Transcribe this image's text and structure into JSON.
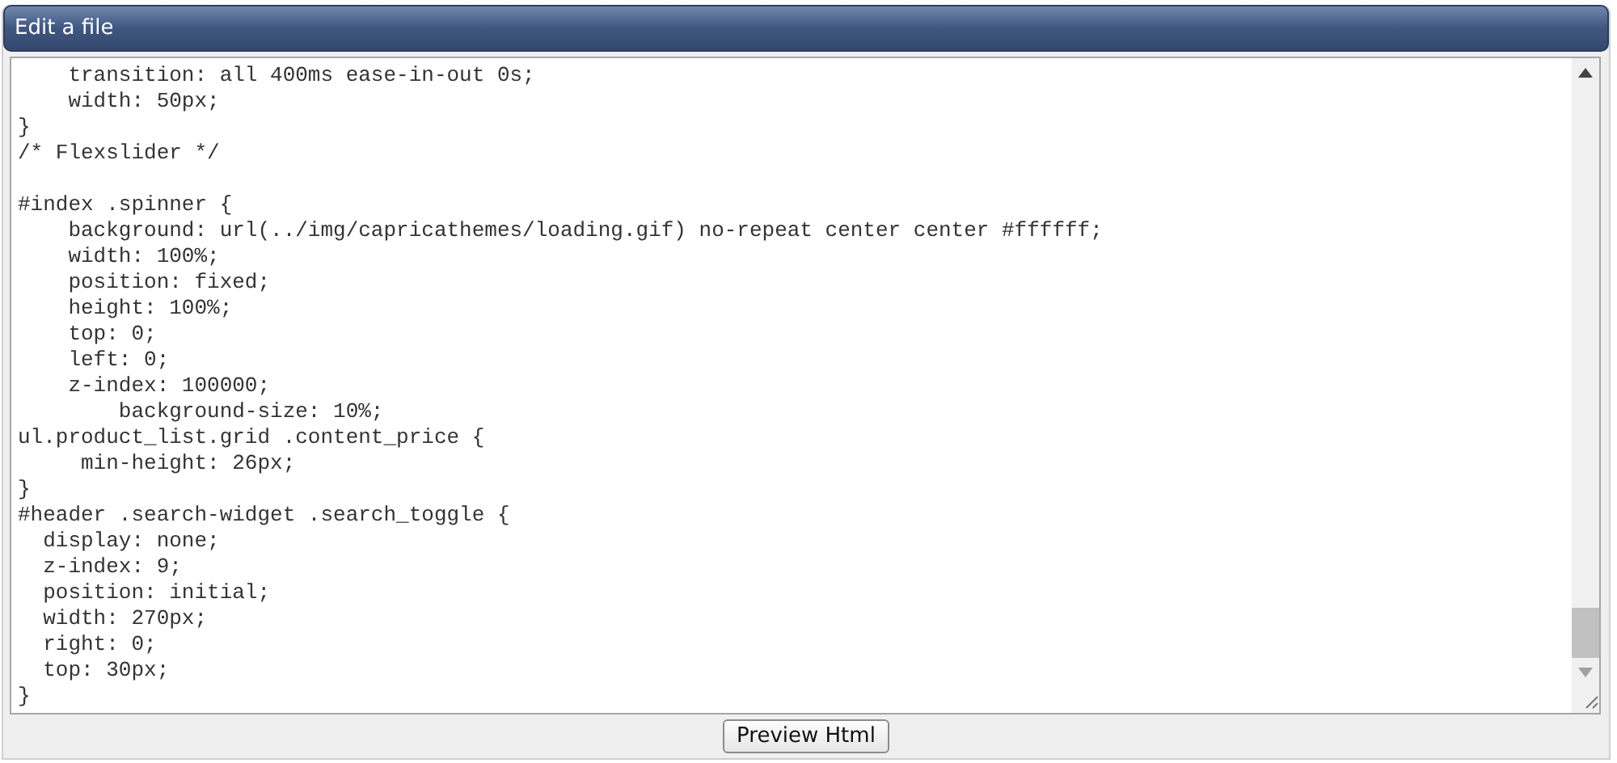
{
  "panel": {
    "title": "Edit a file"
  },
  "editor": {
    "value": "    transition: all 400ms ease-in-out 0s;\n    width: 50px;\n}\n/* Flexslider */\n\n#index .spinner {\n    background: url(../img/capricathemes/loading.gif) no-repeat center center #ffffff;\n    width: 100%;\n    position: fixed;\n    height: 100%;\n    top: 0;\n    left: 0;\n    z-index: 100000;\n        background-size: 10%;\nul.product_list.grid .content_price {\n     min-height: 26px;\n}\n#header .search-widget .search_toggle {\n  display: none;\n  z-index: 9;\n  position: initial;\n  width: 270px;\n  right: 0;\n  top: 30px;\n}"
  },
  "buttons": [
    {
      "label": "Preview Html"
    }
  ]
}
